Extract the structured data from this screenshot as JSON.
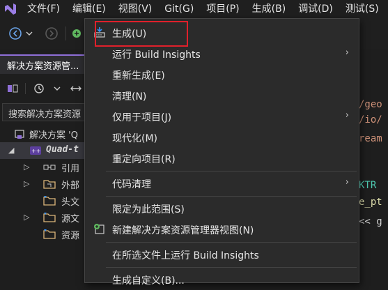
{
  "menubar": {
    "items": [
      "文件(F)",
      "编辑(E)",
      "视图(V)",
      "Git(G)",
      "项目(P)",
      "生成(B)",
      "调试(D)",
      "测试(S)"
    ]
  },
  "solution_explorer": {
    "tab_title": "解决方案资源管...",
    "search_placeholder": "搜索解决方案资源",
    "tree": [
      {
        "label": "解决方案 'Q",
        "icon": "solution-icon"
      },
      {
        "label": "Quad-t",
        "icon": "cpp-project-icon"
      },
      {
        "label": "引用",
        "icon": "references-icon"
      },
      {
        "label": "外部",
        "icon": "external-deps-icon"
      },
      {
        "label": "头文",
        "icon": "folder-icon"
      },
      {
        "label": "源文",
        "icon": "folder-icon"
      },
      {
        "label": "资源",
        "icon": "folder-icon"
      }
    ]
  },
  "editor": {
    "lines": [
      {
        "text": "/geo",
        "color": "#ce9178"
      },
      {
        "text": "/io/",
        "color": "#ce9178"
      },
      {
        "text": "ream",
        "color": "#ce9178"
      },
      {
        "text": "KTR",
        "color": "#4ec9b0"
      },
      {
        "text": "e_pt",
        "color": "#dcdcaa"
      },
      {
        "text": "<< g",
        "color": "#d4d4d4"
      }
    ]
  },
  "context_menu": {
    "items": [
      {
        "label": "生成(U)",
        "icon": "build-icon",
        "submenu": false
      },
      {
        "label": "运行 Build Insights",
        "submenu": true
      },
      {
        "label": "重新生成(E)",
        "submenu": false
      },
      {
        "label": "清理(N)",
        "submenu": false
      },
      {
        "label": "仅用于项目(J)",
        "submenu": true
      },
      {
        "label": "现代化(M)",
        "submenu": false
      },
      {
        "label": "重定向项目(R)",
        "submenu": false
      },
      {
        "label": "代码清理",
        "submenu": true
      },
      {
        "label": "限定为此范围(S)",
        "submenu": false
      },
      {
        "label": "新建解决方案资源管理器视图(N)",
        "icon": "new-view-icon",
        "submenu": false
      },
      {
        "label": "在所选文件上运行 Build Insights",
        "submenu": false
      },
      {
        "label": "生成自定义(B)...",
        "submenu": false
      }
    ],
    "submenu_glyph": "›"
  },
  "colors": {
    "accent": "#8f6fd8",
    "highlight_box": "#e0202b",
    "menu_bg": "#2b2b2b"
  }
}
